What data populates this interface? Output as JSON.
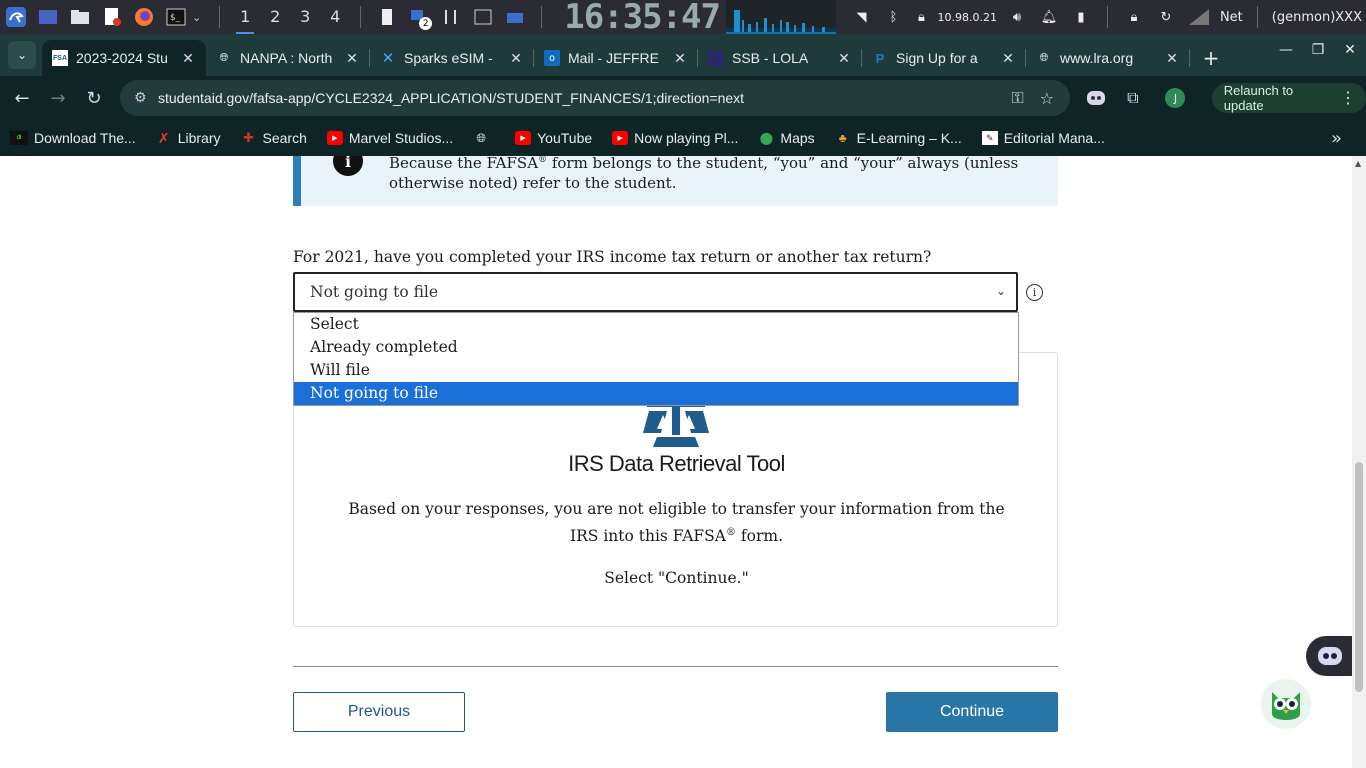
{
  "taskbar": {
    "workspaces": [
      "1",
      "2",
      "3",
      "4"
    ],
    "clock": "16:35:47",
    "ip": "10.98.0.21",
    "net_label": "Net",
    "genmon": "(genmon)XXX",
    "badge": "2"
  },
  "tabs": [
    {
      "title": "2023-2024 Stu",
      "fav": "FSA"
    },
    {
      "title": "NANPA : North",
      "fav": "globe"
    },
    {
      "title": "Sparks eSIM -",
      "fav": "sparks"
    },
    {
      "title": "Mail - JEFFRE",
      "fav": "outlook"
    },
    {
      "title": "SSB - LOLA",
      "fav": "ssb"
    },
    {
      "title": "Sign Up for a",
      "fav": "paypal"
    },
    {
      "title": "www.lra.org",
      "fav": "globe"
    }
  ],
  "address": {
    "url": "studentaid.gov/fafsa-app/CYCLE2324_APPLICATION/STUDENT_FINANCES/1;direction=next",
    "relaunch": "Relaunch to update",
    "avatar": "J"
  },
  "bookmarks": [
    {
      "label": "Download The...",
      "fav": "dl"
    },
    {
      "label": "Library",
      "fav": "lib"
    },
    {
      "label": "Search",
      "fav": "search"
    },
    {
      "label": "Marvel Studios...",
      "fav": "yt"
    },
    {
      "label": "",
      "fav": "globe"
    },
    {
      "label": "YouTube",
      "fav": "yt"
    },
    {
      "label": "Now playing Pl...",
      "fav": "yt"
    },
    {
      "label": "Maps",
      "fav": "maps"
    },
    {
      "label": "E-Learning – K...",
      "fav": "elearn"
    },
    {
      "label": "Editorial Mana...",
      "fav": "edit"
    }
  ],
  "page": {
    "info_icon": "i",
    "info_text_1": "Because the FAFSA",
    "info_reg": "®",
    "info_text_2": " form belongs to the student, “you” and “your” always (unless otherwise noted) refer to the student.",
    "question": "For 2021, have you completed your IRS income tax return or another tax return?",
    "selected_value": "Not going to file",
    "options": [
      "Select",
      "Already completed",
      "Will file",
      "Not going to file"
    ],
    "irs_title": "IRS Data Retrieval Tool",
    "irs_body_1": "Based on your responses, you are not eligible to transfer your information from the IRS into this FAFSA",
    "irs_reg": "®",
    "irs_body_2": " form.",
    "irs_sub": "Select \"Continue.\"",
    "prev_label": "Previous",
    "next_label": "Continue"
  },
  "colors": {
    "accent": "#2876a8",
    "selection": "#1a6fd8",
    "info_bg": "#e8f4fa"
  }
}
